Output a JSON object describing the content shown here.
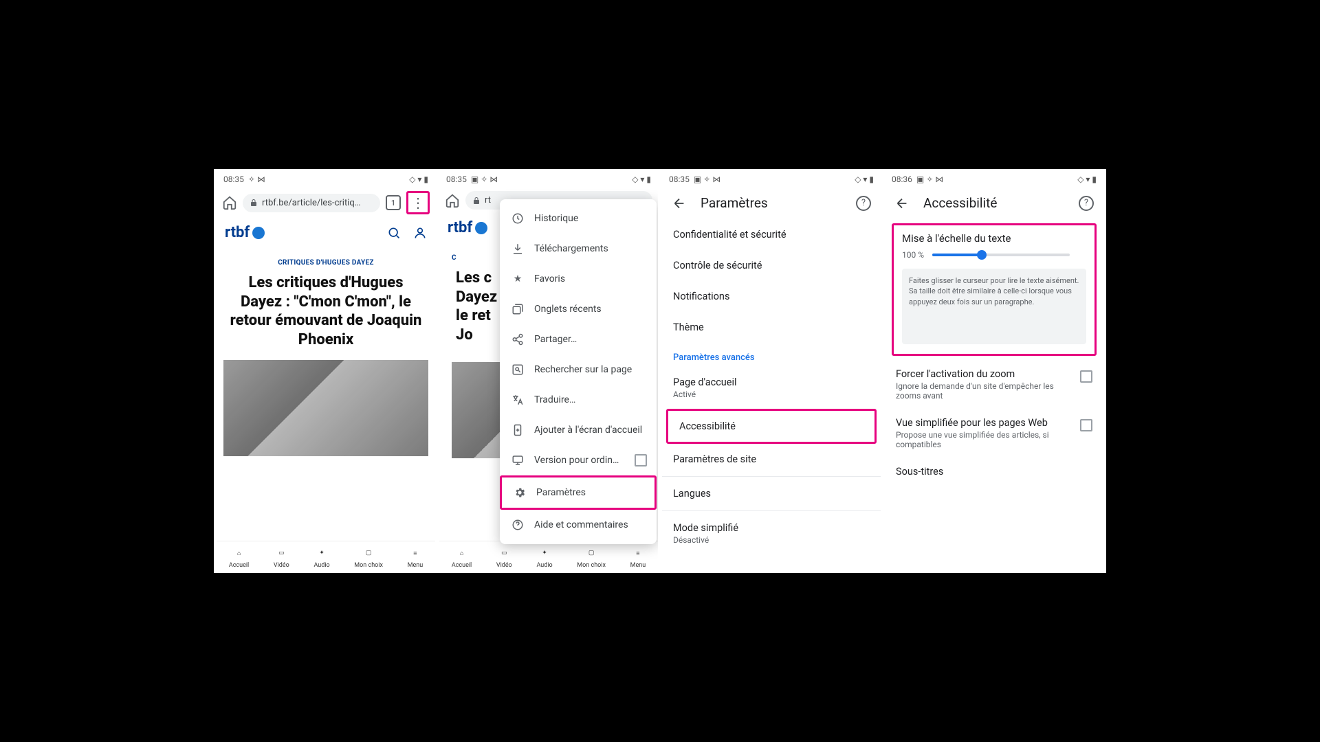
{
  "screens": {
    "s1": {
      "time": "08:35",
      "url": "rtbf.be/article/les-critiq…",
      "tab_count": "1",
      "logo": "rtbf",
      "kicker": "CRITIQUES D'HUGUES DAYEZ",
      "headline": "Les critiques d'Hugues Dayez : \"C'mon C'mon\", le retour émouvant de Joaquin Phoenix",
      "nav": [
        "Accueil",
        "Vidéo",
        "Audio",
        "Mon choix",
        "Menu"
      ]
    },
    "s2": {
      "time": "08:35",
      "url_partial": "rt",
      "logo": "rtbf",
      "kicker": "C",
      "headline_partial": "Les c\nDayez\nle ret\nJo",
      "nav": [
        "Accueil",
        "Vidéo",
        "Audio",
        "Mon choix",
        "Menu"
      ],
      "menu": {
        "history": "Historique",
        "downloads": "Téléchargements",
        "bookmarks": "Favoris",
        "recent_tabs": "Onglets récents",
        "share": "Partager…",
        "find": "Rechercher sur la page",
        "translate": "Traduire…",
        "add_home": "Ajouter à l'écran d'accueil",
        "desktop": "Version pour ordin…",
        "settings": "Paramètres",
        "help": "Aide et commentaires"
      }
    },
    "s3": {
      "time": "08:35",
      "title": "Paramètres",
      "items": {
        "privacy": "Confidentialité et sécurité",
        "safety": "Contrôle de sécurité",
        "notifications": "Notifications",
        "theme": "Thème",
        "advanced": "Paramètres avancés",
        "homepage": "Page d'accueil",
        "homepage_sub": "Activé",
        "accessibility": "Accessibilité",
        "site_settings": "Paramètres de site",
        "languages": "Langues",
        "simplified": "Mode simplifié",
        "simplified_sub": "Désactivé"
      }
    },
    "s4": {
      "time": "08:36",
      "title": "Accessibilité",
      "text_scaling": {
        "label": "Mise à l'échelle du texte",
        "value": "100 %",
        "sample": "Faites glisser le curseur pour lire le texte aisément. Sa taille doit être similaire à celle-ci lorsque vous appuyez deux fois sur un paragraphe."
      },
      "force_zoom": {
        "title": "Forcer l'activation du zoom",
        "sub": "Ignore la demande d'un site d'empêcher les zooms avant"
      },
      "reader": {
        "title": "Vue simplifiée pour les pages Web",
        "sub": "Propose une vue simplifiée des articles, si compatibles"
      },
      "captions": "Sous-titres"
    }
  }
}
